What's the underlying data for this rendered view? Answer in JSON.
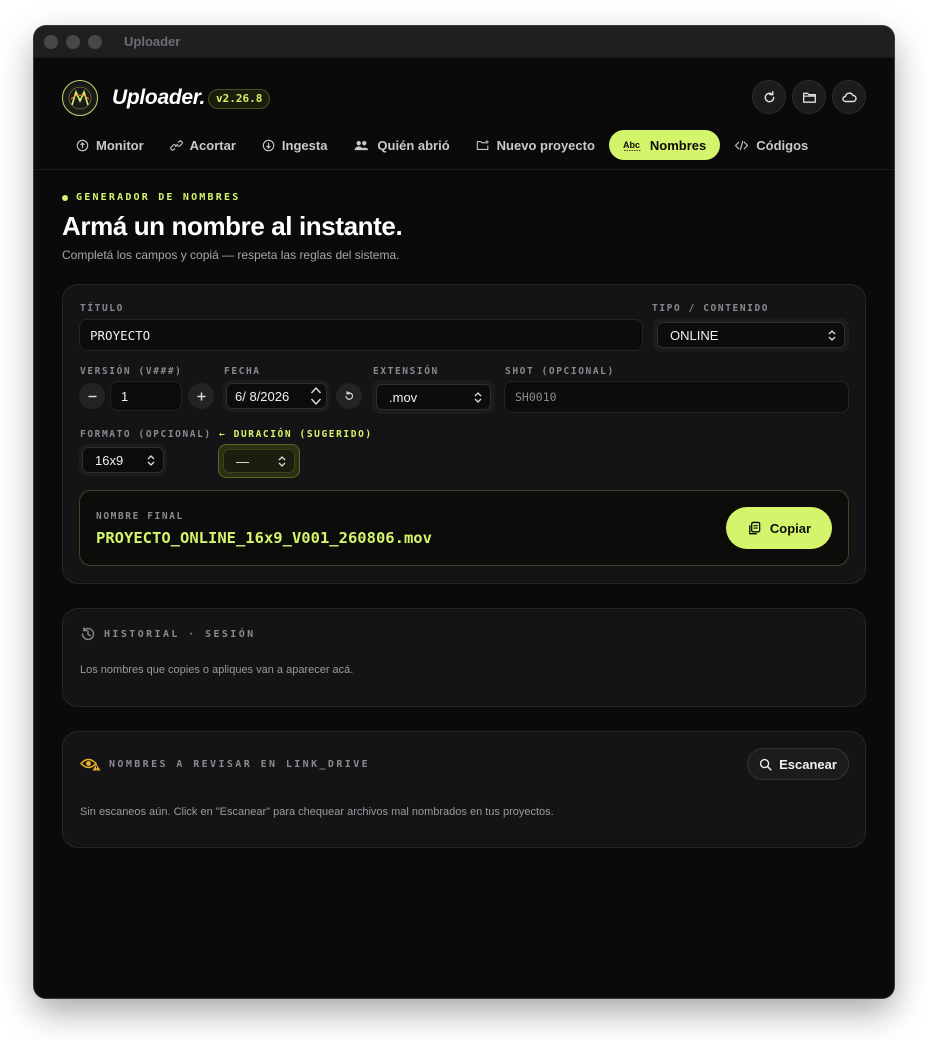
{
  "window": {
    "title": "Uploader"
  },
  "header": {
    "brand": "Uploader.",
    "version": "v2.26.8",
    "icons": [
      "refresh-icon",
      "folder-icon",
      "cloud-icon"
    ]
  },
  "tabs": [
    {
      "label": "Monitor",
      "icon": "upload-circle-icon"
    },
    {
      "label": "Acortar",
      "icon": "link-icon"
    },
    {
      "label": "Ingesta",
      "icon": "download-circle-icon"
    },
    {
      "label": "Quién abrió",
      "icon": "users-icon"
    },
    {
      "label": "Nuevo proyecto",
      "icon": "folder-plus-icon"
    },
    {
      "label": "Nombres",
      "icon": "abc-icon",
      "active": true
    },
    {
      "label": "Códigos",
      "icon": "code-icon"
    }
  ],
  "section": {
    "eyebrow": "GENERADOR DE NOMBRES",
    "title": "Armá un nombre al instante.",
    "subtitle": "Completá los campos y copiá — respeta las reglas del sistema."
  },
  "form": {
    "titulo_label": "TÍTULO",
    "titulo_value": "PROYECTO",
    "tipo_label": "TIPO / CONTENIDO",
    "tipo_value": "ONLINE",
    "version_label": "VERSIÓN (V###)",
    "version_value": "1",
    "fecha_label": "FECHA",
    "fecha_day": "6/",
    "fecha_rest": "8/2026",
    "extension_label": "EXTENSIÓN",
    "extension_value": ".mov",
    "shot_label": "SHOT (OPCIONAL)",
    "shot_placeholder": "SH0010",
    "formato_label": "FORMATO (OPCIONAL)",
    "formato_value": "16x9",
    "duracion_label": "← DURACIÓN (SUGERIDO)",
    "duracion_value": "—"
  },
  "final": {
    "label": "NOMBRE FINAL",
    "value": "PROYECTO_ONLINE_16x9_V001_260806.mov",
    "copy_label": "Copiar"
  },
  "historial": {
    "title": "HISTORIAL · SESIÓN",
    "empty_text": "Los nombres que copies o apliques van a aparecer acá."
  },
  "revisar": {
    "title": "NOMBRES A REVISAR EN LINK_DRIVE",
    "button": "Escanear",
    "empty_text": "Sin escaneos aún. Click en \"Escanear\" para chequear archivos mal nombrados en tus proyectos."
  },
  "colors": {
    "accent": "#d4f56b",
    "background": "#0a0a0b",
    "card": "#141416",
    "warning": "#f0b429"
  }
}
